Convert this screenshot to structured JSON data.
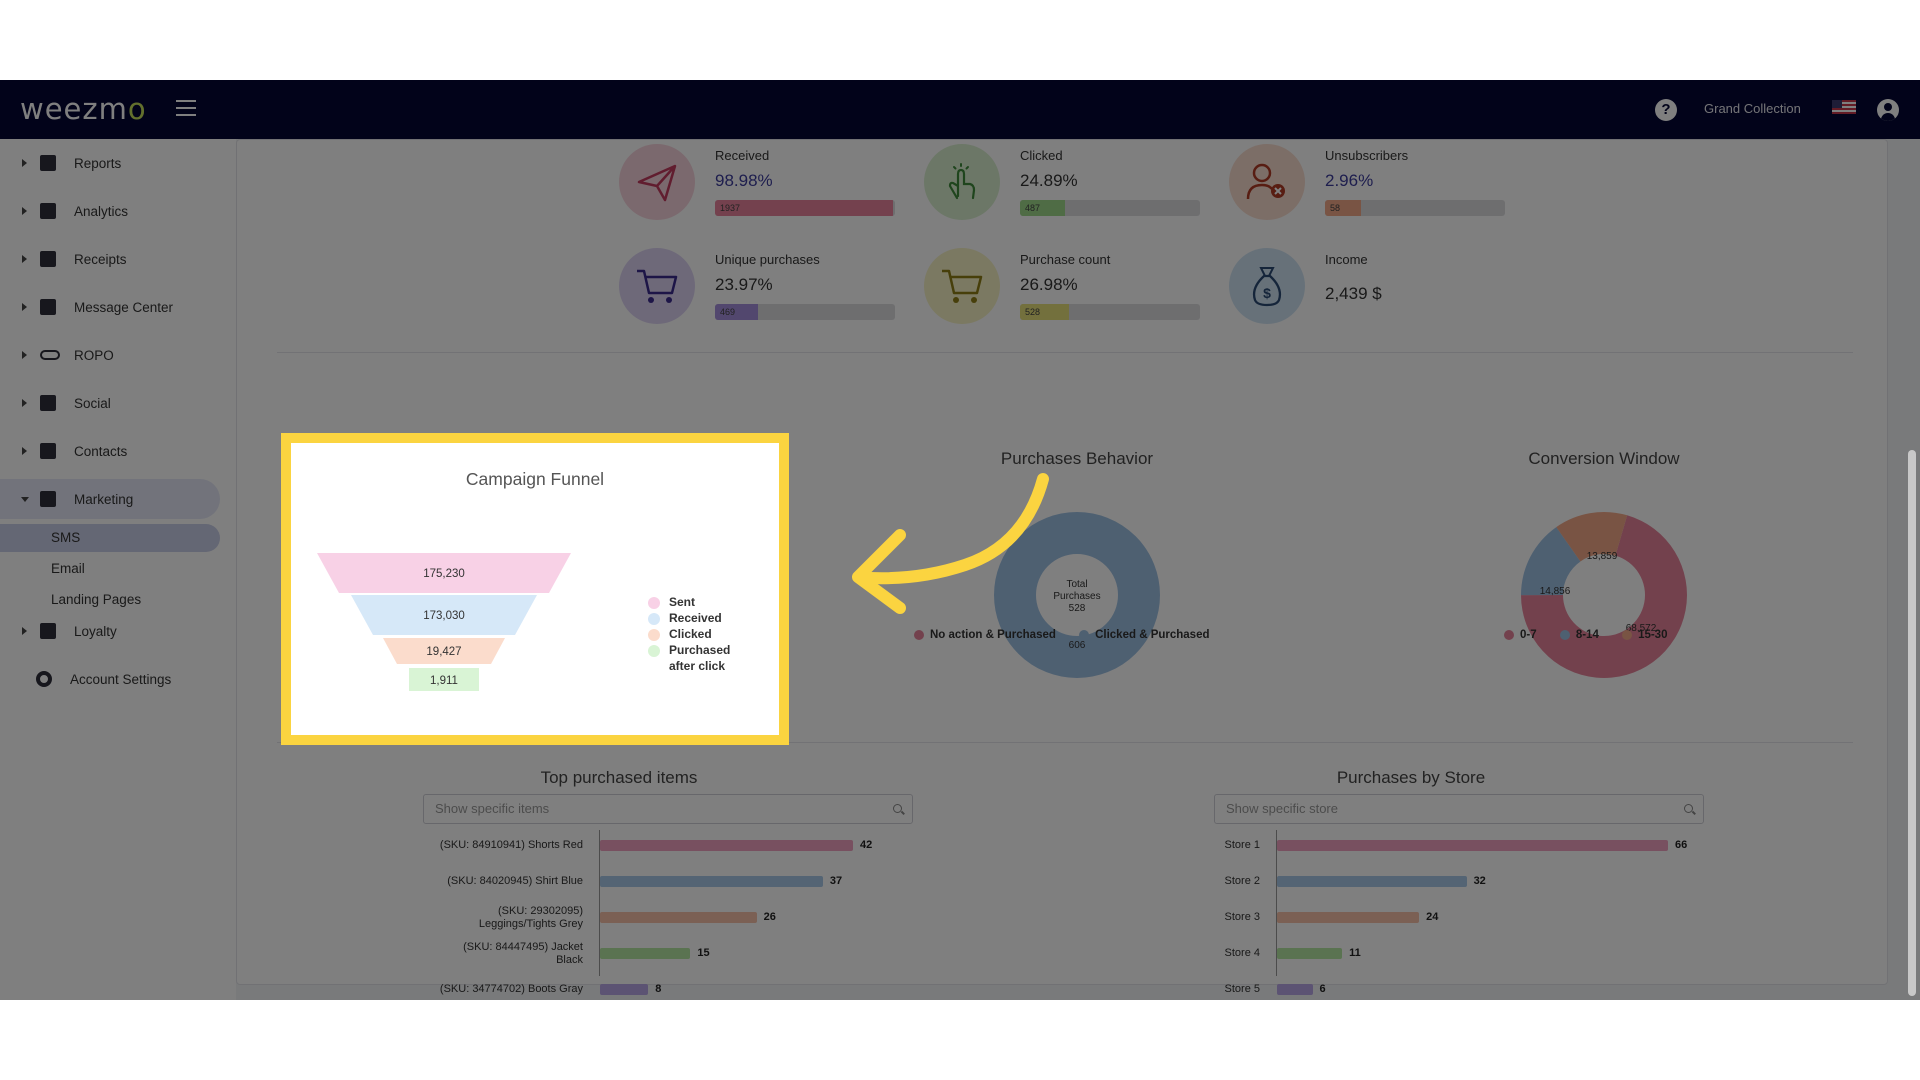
{
  "app": {
    "logo_text": "weezm",
    "logo_o": "o"
  },
  "topbar": {
    "help_icon": "?",
    "store_name": "Grand Collection"
  },
  "sidebar": {
    "items": [
      {
        "label": "Reports"
      },
      {
        "label": "Analytics"
      },
      {
        "label": "Receipts"
      },
      {
        "label": "Message Center"
      },
      {
        "label": "ROPO"
      },
      {
        "label": "Social"
      },
      {
        "label": "Contacts"
      },
      {
        "label": "Marketing"
      },
      {
        "label": "Loyalty"
      },
      {
        "label": "Account Settings"
      }
    ],
    "sub_items": [
      {
        "label": "SMS"
      },
      {
        "label": "Email"
      },
      {
        "label": "Landing Pages"
      }
    ]
  },
  "metrics": [
    {
      "label": "Received",
      "value": "98.98%",
      "bar_label": "1937",
      "fraction": 0.99,
      "color": "#e8839d",
      "bg": "#f6d3dc",
      "icon": "paper-plane-icon"
    },
    {
      "label": "Clicked",
      "value": "24.89%",
      "bar_label": "487",
      "fraction": 0.25,
      "color": "#9ed88a",
      "bg": "#d9efcf",
      "icon": "pointer-hand-icon"
    },
    {
      "label": "Unsubscribers",
      "value": "2.96%",
      "bar_label": "58",
      "fraction": 0.03,
      "color": "#f3a888",
      "bg": "#f9dccf",
      "icon": "user-remove-icon"
    },
    {
      "label": "Unique purchases",
      "value": "23.97%",
      "bar_label": "469",
      "fraction": 0.24,
      "color": "#a58fdc",
      "bg": "#ddd3f3",
      "icon": "cart-icon"
    },
    {
      "label": "Purchase count",
      "value": "26.98%",
      "bar_label": "528",
      "fraction": 0.27,
      "color": "#e7e17a",
      "bg": "#f6f2c4",
      "icon": "cart-icon"
    },
    {
      "label": "Income",
      "value": "2,439 $",
      "icon": "money-bag-icon",
      "bg": "#cfe3f3"
    }
  ],
  "funnel": {
    "title": "Campaign Funnel",
    "values": [
      "175,230",
      "173,030",
      "19,427",
      "1,911"
    ],
    "legend": [
      "Sent",
      "Received",
      "Clicked",
      "Purchased",
      "after click"
    ],
    "colors": [
      "#f8d1e6",
      "#d6e8f8",
      "#fbdccc",
      "#d9f4d5"
    ]
  },
  "purchases_behavior": {
    "title": "Purchases Behavior",
    "center": [
      "Total",
      "Purchases",
      "528"
    ],
    "slice_label": "606",
    "legend": [
      "No action & Purchased",
      "Clicked & Purchased"
    ],
    "colors": [
      "#e7839a",
      "#9dc0e3"
    ]
  },
  "conversion_window": {
    "title": "Conversion Window",
    "labels": [
      "13,859",
      "14,856",
      "68,572"
    ],
    "legend": [
      "0-7",
      "8-14",
      "15-30"
    ],
    "colors": [
      "#e7839a",
      "#9dc0e3",
      "#f3a888"
    ]
  },
  "top_items": {
    "title": "Top purchased items",
    "placeholder": "Show specific items",
    "rows": [
      {
        "label1": "(SKU: 84910941) Shorts Red",
        "label2": "",
        "value": 42,
        "color": "#f1a1c0"
      },
      {
        "label1": "(SKU: 84020945) Shirt Blue",
        "label2": "",
        "value": 37,
        "color": "#a9c9e8"
      },
      {
        "label1": "(SKU: 29302095)",
        "label2": "Leggings/Tights Grey",
        "value": 26,
        "color": "#f6c1a8"
      },
      {
        "label1": "(SKU: 84447495) Jacket",
        "label2": "Black",
        "value": 15,
        "color": "#b5e6a2"
      },
      {
        "label1": "(SKU: 34774702) Boots Gray",
        "label2": "",
        "value": 8,
        "color": "#b8a7e6"
      }
    ]
  },
  "stores": {
    "title": "Purchases by Store",
    "placeholder": "Show specific store",
    "rows": [
      {
        "label": "Store 1",
        "value": 66,
        "color": "#f1a1c0"
      },
      {
        "label": "Store 2",
        "value": 32,
        "color": "#a9c9e8"
      },
      {
        "label": "Store 3",
        "value": 24,
        "color": "#f6c1a8"
      },
      {
        "label": "Store 4",
        "value": 11,
        "color": "#b5e6a2"
      },
      {
        "label": "Store 5",
        "value": 6,
        "color": "#b8a7e6"
      }
    ]
  },
  "colors": {
    "highlight": "#fbd440",
    "arrow": "#fbd440",
    "topbar": "#040734"
  }
}
